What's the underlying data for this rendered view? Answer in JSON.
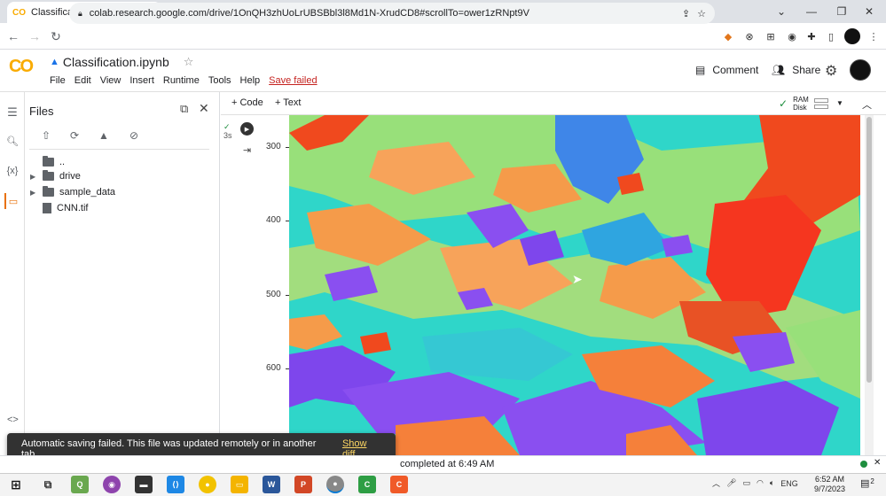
{
  "browser": {
    "tab_title": "Classification.ipynb - Colaborato",
    "new_tab": "+",
    "url": "colab.research.google.com/drive/1OnQH3zhUoLrUBSBbl3l8Md1N-XrudCD8#scrollTo=ower1zRNpt9V",
    "window_controls": [
      "⌄",
      "—",
      "❐",
      "✕"
    ]
  },
  "colab": {
    "logo": "CO",
    "notebook_title": "Classification.ipynb",
    "menu": [
      "File",
      "Edit",
      "View",
      "Insert",
      "Runtime",
      "Tools",
      "Help"
    ],
    "save_status": "Save failed",
    "comment_label": "Comment",
    "share_label": "Share",
    "add_code": "+ Code",
    "add_text": "+ Text",
    "ram_label": "RAM",
    "disk_label": "Disk"
  },
  "files_panel": {
    "title": "Files",
    "rail_variables": "{x}",
    "items": [
      {
        "name": "..",
        "type": "up"
      },
      {
        "name": "drive",
        "type": "folder"
      },
      {
        "name": "sample_data",
        "type": "folder"
      },
      {
        "name": "CNN.tif",
        "type": "file"
      }
    ]
  },
  "cell": {
    "exec_time": "3s",
    "y_ticks": [
      "300",
      "400",
      "500",
      "600"
    ]
  },
  "snackbar": {
    "message": "Automatic saving failed. This file was updated remotely or in another tab.",
    "action": "Show diff"
  },
  "status": {
    "text": "completed at 6:49 AM"
  },
  "taskbar": {
    "tray_lang": "ENG",
    "time": "6:52 AM",
    "date": "9/7/2023",
    "notif_count": "2"
  }
}
